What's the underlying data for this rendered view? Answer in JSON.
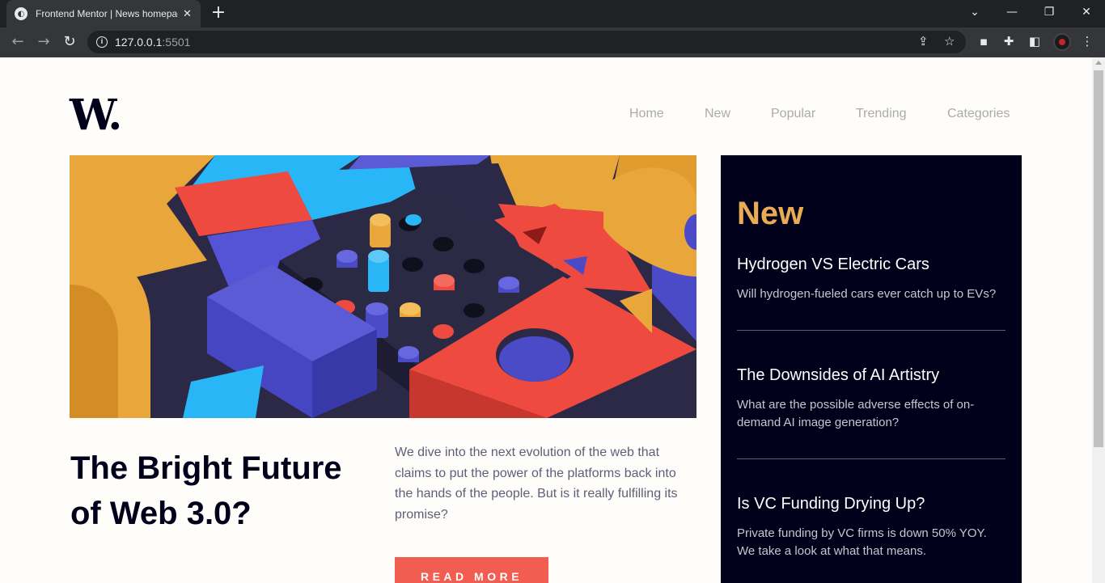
{
  "browser": {
    "tab_title": "Frontend Mentor | News homepage",
    "url_host": "127.0.0.1",
    "url_port": ":5501"
  },
  "site": {
    "logo": "W.",
    "nav": [
      "Home",
      "New",
      "Popular",
      "Trending",
      "Categories"
    ]
  },
  "article": {
    "headline": "The Bright Future of Web 3.0?",
    "description": "We dive into the next evolution of the web that claims to put the power of the platforms back into the hands of the people. But is it really fulfilling its promise?",
    "cta": "READ MORE"
  },
  "sidebar": {
    "title": "New",
    "items": [
      {
        "title": "Hydrogen VS Electric Cars",
        "text": "Will hydrogen-fueled cars ever catch up to EVs?"
      },
      {
        "title": "The Downsides of AI Artistry",
        "text": "What are the possible adverse effects of on-demand AI image generation?"
      },
      {
        "title": "Is VC Funding Drying Up?",
        "text": "Private funding by VC firms is down 50% YOY. We take a look at what that means."
      }
    ]
  },
  "colors": {
    "soft_orange": "#e9ab53",
    "soft_red": "#f15d51",
    "very_dark_blue": "#00001a",
    "grayish_blue": "#5d5f79",
    "off_white": "#fffdfa"
  }
}
